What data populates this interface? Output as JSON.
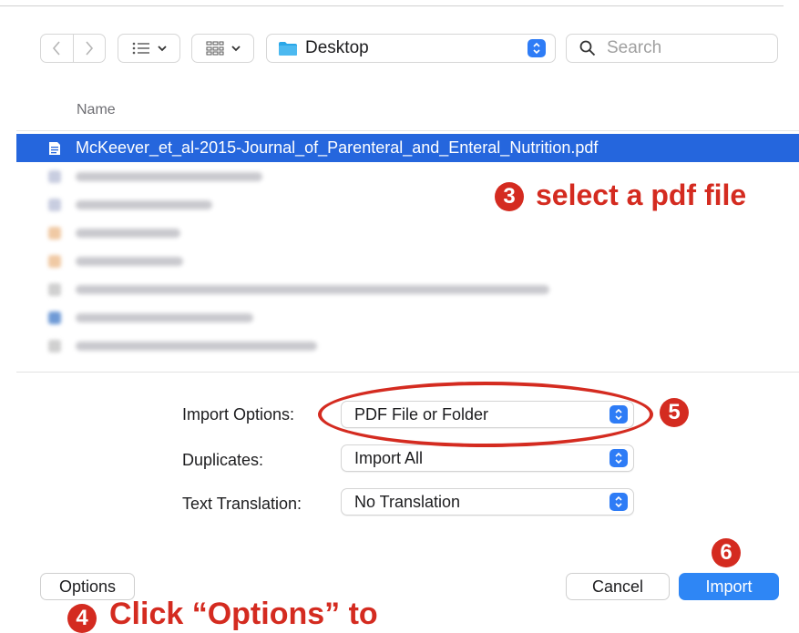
{
  "toolbar": {
    "location": "Desktop",
    "search_placeholder": "Search"
  },
  "file_list": {
    "column_header": "Name",
    "selected_file": "McKeever_et_al-2015-Journal_of_Parenteral_and_Enteral_Nutrition.pdf"
  },
  "options": {
    "import_options_label": "Import Options:",
    "import_options_value": "PDF File or Folder",
    "duplicates_label": "Duplicates:",
    "duplicates_value": "Import All",
    "text_translation_label": "Text Translation:",
    "text_translation_value": "No Translation"
  },
  "buttons": {
    "options": "Options",
    "cancel": "Cancel",
    "import": "Import"
  },
  "annotations": {
    "step3_text": "select a pdf file",
    "step3_number": "3",
    "step4_text": "Click “Options” to",
    "step4_number": "4",
    "step5_number": "5",
    "step6_number": "6"
  },
  "colors": {
    "accent": "#2e86f5",
    "selection": "#2566dd",
    "annotation": "#d42b20"
  }
}
